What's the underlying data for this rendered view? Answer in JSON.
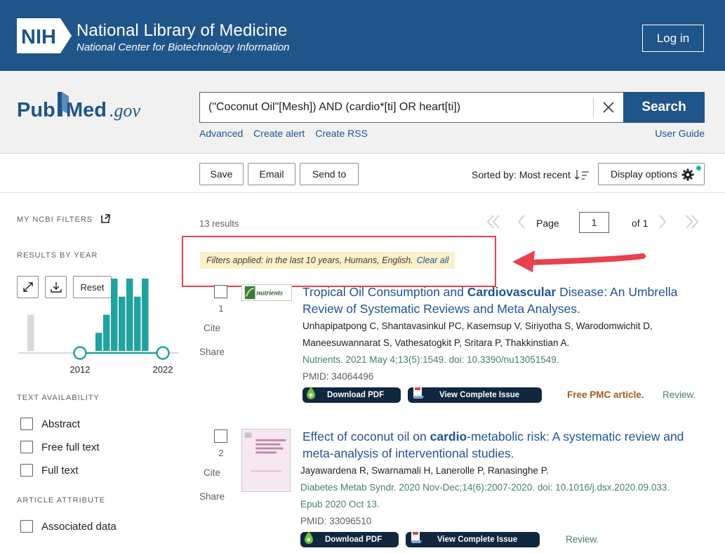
{
  "header": {
    "title": "National Library of Medicine",
    "subtitle": "National Center for Biotechnology Information",
    "login_label": "Log in",
    "logo_text": "NIH"
  },
  "search": {
    "logo_pub": "Pub",
    "logo_med": "Med",
    "logo_gov": ".gov",
    "query": "(\"Coconut Oil\"[Mesh]) AND (cardio*[ti] OR heart[ti])",
    "button_label": "Search",
    "links": [
      "Advanced",
      "Create alert",
      "Create RSS"
    ],
    "user_guide": "User Guide"
  },
  "actions": {
    "save": "Save",
    "email": "Email",
    "send_to": "Send to",
    "sorted_by": "Sorted by: Most recent",
    "display_options": "Display options"
  },
  "sidebar": {
    "my_ncbi_filters": "MY NCBI FILTERS",
    "results_by_year": "RESULTS BY YEAR",
    "reset": "Reset",
    "year_start": "2012",
    "year_end": "2022",
    "text_availability": "TEXT AVAILABILITY",
    "text_options": [
      "Abstract",
      "Free full text",
      "Full text"
    ],
    "article_attribute": "ARTICLE ATTRIBUTE",
    "attribute_options": [
      "Associated data"
    ]
  },
  "chart_data": {
    "type": "bar",
    "bars_out_of_range": [
      2
    ],
    "bars_in_range": [
      1,
      2,
      4,
      3,
      4,
      3,
      4
    ],
    "ylim": [
      0,
      4
    ]
  },
  "results": {
    "count": "13 results",
    "page_label": "Page",
    "page_value": "1",
    "of_label": "of 1",
    "filters_text": "Filters applied: in the last 10 years, Humans, English.",
    "clear_all": "Clear all",
    "cite": "Cite",
    "share": "Share",
    "items": [
      {
        "num": "1",
        "title_a": "Tropical Oil Consumption and ",
        "title_bold": "Cardiovascular",
        "title_b": " Disease: An Umbrella Review of Systematic Reviews and Meta Analyses.",
        "authors": "Unhapipatpong C, Shantavasinkul PC, Kasemsup V, Siriyotha S, Warodomwichit D, Maneesuwannarat S, Vathesatogkit P, Sritara P, Thakkinstian A.",
        "authors_line1": "Unhapipatpong C, Shantavasinkul PC, Kasemsup V, Siriyotha S, Warodomwichit D,",
        "authors_line2": "Maneesuwannarat S, Vathesatogkit P, Sritara P, Thakkinstian A.",
        "journal": "Nutrients. 2021 May 4;13(5):1549. doi: 10.3390/nu13051549.",
        "pmid": "PMID: 34064496",
        "download": "Download PDF",
        "issue": "View Complete Issue",
        "free": "Free PMC article.",
        "type": "Review.",
        "thumb_text": "nutrients"
      },
      {
        "num": "2",
        "title_a": "Effect of coconut oil on ",
        "title_bold": "cardio",
        "title_b": "-metabolic risk: A systematic review and meta-analysis of interventional studies.",
        "authors_line1": "Jayawardena R, Swarnamali H, Lanerolle P, Ranasinghe P.",
        "journal_line1": "Diabetes Metab Syndr. 2020 Nov-Dec;14(6):2007-2020. doi: 10.1016/j.dsx.2020.09.033.",
        "journal_line2": "Epub 2020 Oct 13.",
        "pmid": "PMID: 33096510",
        "download": "Download PDF",
        "issue": "View Complete Issue",
        "type": "Review."
      }
    ]
  },
  "colors": {
    "nih_blue": "#20558a",
    "link_blue": "#205493",
    "teal": "#20a39e",
    "filter_bg": "#fbf1c9",
    "highlight_red": "#e8424d"
  }
}
